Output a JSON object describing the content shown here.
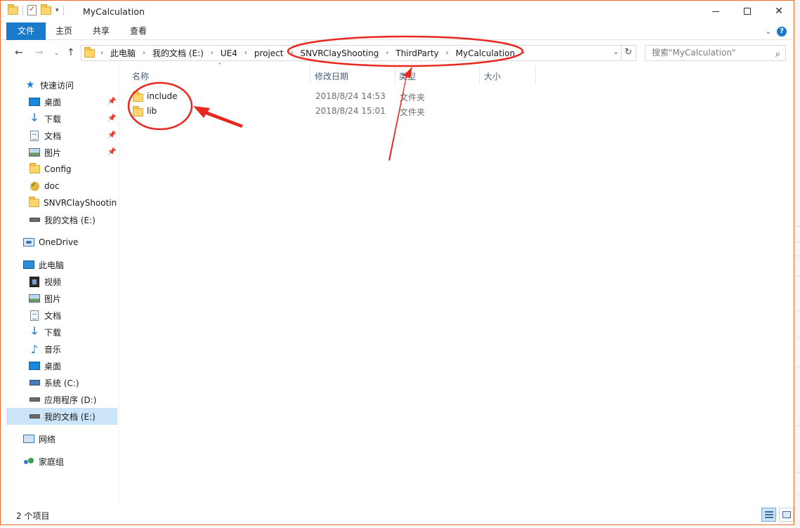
{
  "window": {
    "title": "MyCalculation",
    "minimize_icon": "minimize-icon",
    "maximize_icon": "maximize-icon",
    "close_glyph": "✕"
  },
  "ribbon": {
    "tabs": [
      {
        "label": "文件"
      },
      {
        "label": "主页"
      },
      {
        "label": "共享"
      },
      {
        "label": "查看"
      }
    ],
    "help_glyph": "?"
  },
  "address_bar": {
    "crumbs": [
      "此电脑",
      "我的文档 (E:)",
      "UE4",
      "project",
      "SNVRClayShooting",
      "ThirdParty",
      "MyCalculation"
    ],
    "search_placeholder": "搜索\"MyCalculation\""
  },
  "nav_pane": {
    "quick_access": "快速访问",
    "quick_items": [
      {
        "label": "桌面",
        "icon": "desktop-icon",
        "pinned": true
      },
      {
        "label": "下载",
        "icon": "download-icon",
        "pinned": true
      },
      {
        "label": "文档",
        "icon": "document-icon",
        "pinned": true
      },
      {
        "label": "图片",
        "icon": "pictures-icon",
        "pinned": true
      },
      {
        "label": "Config",
        "icon": "folder-icon"
      },
      {
        "label": "doc",
        "icon": "synced-folder-icon"
      },
      {
        "label": "SNVRClayShooting",
        "icon": "folder-icon"
      },
      {
        "label": "我的文档 (E:)",
        "icon": "drive-icon"
      }
    ],
    "onedrive": "OneDrive",
    "this_pc": "此电脑",
    "pc_items": [
      {
        "label": "视频",
        "icon": "video-icon"
      },
      {
        "label": "图片",
        "icon": "pictures-icon"
      },
      {
        "label": "文档",
        "icon": "document-icon"
      },
      {
        "label": "下载",
        "icon": "download-icon"
      },
      {
        "label": "音乐",
        "icon": "music-icon"
      },
      {
        "label": "桌面",
        "icon": "desktop-icon"
      },
      {
        "label": "系统 (C:)",
        "icon": "system-drive-icon"
      },
      {
        "label": "应用程序 (D:)",
        "icon": "drive-icon"
      },
      {
        "label": "我的文档 (E:)",
        "icon": "drive-icon",
        "selected": true
      }
    ],
    "network": "网络",
    "homegroup": "家庭组"
  },
  "file_list": {
    "columns": {
      "name": "名称",
      "date": "修改日期",
      "type": "类型",
      "size": "大小"
    },
    "rows": [
      {
        "name": "include",
        "date": "2018/8/24 14:53",
        "type": "文件夹",
        "size": ""
      },
      {
        "name": "lib",
        "date": "2018/8/24 15:01",
        "type": "文件夹",
        "size": ""
      }
    ]
  },
  "status_bar": {
    "item_count": "2 个项目"
  },
  "annotation_color": "#e8271f",
  "colors": {
    "accent": "#1979ca",
    "window_border": "#ee6b2f",
    "selection": "#cce4f7"
  }
}
